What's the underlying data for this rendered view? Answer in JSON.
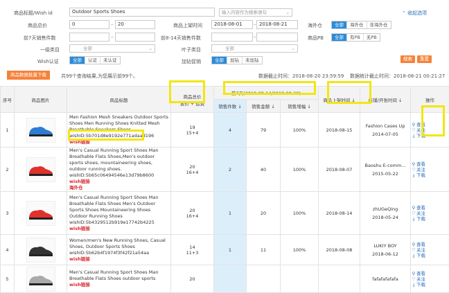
{
  "filters": {
    "title_label": "商品标题/Wish id",
    "title_value": "Outdoor Sports Shoes",
    "lang_placeholder": "输入内容作为搜索语句",
    "collapse_label": "收起选项",
    "price_label": "商品总价",
    "price_min": "0",
    "price_max": "20",
    "listed_label": "商品上架时间",
    "listed_from": "2018-08-01",
    "listed_to": "2018-08-21",
    "overseas_label": "海外仓",
    "overseas_options": [
      "全部",
      "海外仓",
      "非海外仓"
    ],
    "sales7_label": "前7天销售件数",
    "sales8_label": "前8-14天销售件数",
    "pb_label": "商品PB",
    "pb_options": [
      "全部",
      "有PB",
      "无PB"
    ],
    "cat1_label": "一级类目",
    "cat1_value": "全部",
    "leaf_label": "叶子类目",
    "leaf_value": "全部",
    "wish_cert_label": "Wish认证",
    "wish_cert_options": [
      "全部",
      "认证",
      "未认证"
    ],
    "express_label": "加钻促销",
    "express_options": [
      "全部",
      "加钻",
      "未加钻"
    ],
    "search_btn": "搜索",
    "reset_btn": "重置"
  },
  "toolbar": {
    "download_btn": "商品数据批量下载",
    "count_text": "共99个查询结果,为您展示前99个。",
    "data_cutoff": "数据截止时间：2018-08-20 23:59:59",
    "stats_cutoff": "数据统计截止时间：2018-08-21 00:21:27"
  },
  "table": {
    "col_index": "序号",
    "col_image": "商品图片",
    "col_title": "商品标题",
    "col_price_1": "商品总价",
    "col_price_2": "售价 + 运费",
    "col_group": "前7天(2018-08-14/2018-08-20)",
    "col_sales_qty": "销售件数",
    "col_sales_amt": "销售金额",
    "col_growth": "销售增幅",
    "col_listed": "商品上架时间",
    "col_store": "店铺/开张时间",
    "col_ops": "操作",
    "op_view": "查看",
    "op_follow": "关注",
    "op_download": "下载",
    "wish_link": "wish链接",
    "rows": [
      {
        "index": "1",
        "title": "Men Fashion Mesh Sneakers Outdoor Sports Shoes Men Running Shoes Knitted Mesh Breathable Sneakers Shoes",
        "wish_id": "wishID:5b701d8e9192e771adaad196",
        "overseas": "",
        "price_total": "19",
        "price_detail": "15+4",
        "qty": "4",
        "amount": "79",
        "growth": "100%",
        "listed": "2018-08-15",
        "store": "Fashion Cases Up",
        "opened": "2014-07-05",
        "color": "#2e7bd6"
      },
      {
        "index": "2",
        "title": "Men's Casual Running Sport Shoes Man Breathable Flats Shoes,Men's outdoor sports shoes, mountaineering shoes, outdoor running shoes.",
        "wish_id": "wishID:5b65c06494546e13d79b8600",
        "overseas": "海外仓",
        "price_total": "20",
        "price_detail": "16+4",
        "qty": "2",
        "amount": "40",
        "growth": "100%",
        "listed": "2018-08-07",
        "store": "Baoshu E-comm...",
        "opened": "2015-05-22",
        "color": "#e2302b"
      },
      {
        "index": "3",
        "title": "Men's Casual Running Sport Shoes Man Breathable Flats Shoes Men's Outdoor Sports Shoes Mountaineering Shoes Outdoor Running Shoes",
        "wish_id": "wishID:5b4329512b919e17742b4225",
        "overseas": "",
        "price_total": "20",
        "price_detail": "16+4",
        "qty": "1",
        "amount": "20",
        "growth": "100%",
        "listed": "2018-08-14",
        "store": "zhUGeQing",
        "opened": "2018-05-24",
        "color": "#e2302b"
      },
      {
        "index": "4",
        "title": "Women/men's New Running Shoes, Casual Shoes, Outdoor Sports Shoes",
        "wish_id": "wishID:5b62b4f1974f3f42f21a54aa",
        "overseas": "",
        "price_total": "14",
        "price_detail": "11+3",
        "qty": "1",
        "amount": "11",
        "growth": "100%",
        "listed": "2018-08-08",
        "store": "LUKIY BOY",
        "opened": "2018-06-12",
        "color": "#333333"
      },
      {
        "index": "5",
        "title": "Men's Casual Running Sport Shoes Man Breathable Flats Shoes outdoor sports",
        "wish_id": "",
        "overseas": "",
        "price_total": "20",
        "price_detail": "",
        "qty": "",
        "amount": "",
        "growth": "",
        "listed": "",
        "store": "fafafafafafa",
        "opened": "",
        "color": "#aaaaaa"
      }
    ]
  },
  "colors": {
    "accent": "#2a8bd9",
    "orange": "#f6823a",
    "link_red": "#d9272e",
    "highlight": "#f2e611"
  }
}
